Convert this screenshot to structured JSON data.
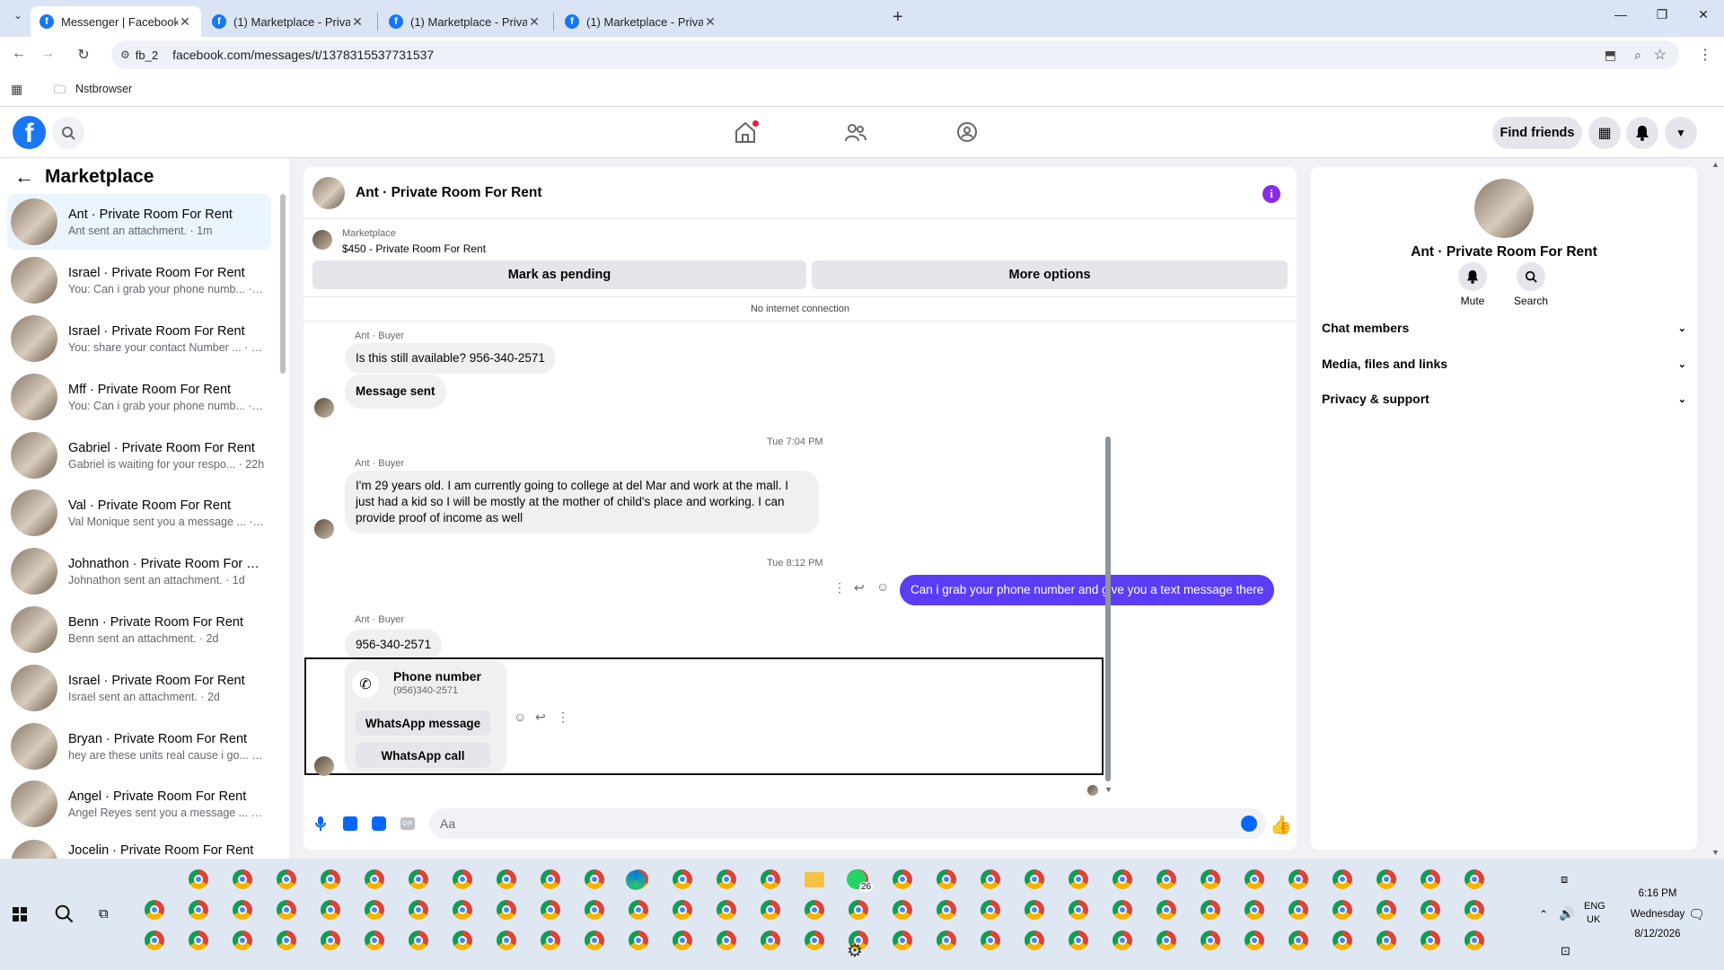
{
  "browser": {
    "tabs": [
      {
        "title": "Messenger | Facebook",
        "active": true
      },
      {
        "title": "(1) Marketplace - Private Room",
        "active": false
      },
      {
        "title": "(1) Marketplace - Private Room",
        "active": false
      },
      {
        "title": "(1) Marketplace - Private Room",
        "active": false
      }
    ],
    "site_chip": "fb_2",
    "url": "facebook.com/messages/t/1378315537731537",
    "bookmark": "Nstbrowser"
  },
  "fb_header": {
    "find_friends": "Find friends",
    "brand_color": "#1877f2"
  },
  "sidebar": {
    "title": "Marketplace",
    "conversations": [
      {
        "name": "Ant · Private Room For Rent",
        "preview": "Ant sent an attachment. · 1m",
        "selected": true
      },
      {
        "name": "Israel · Private Room For Rent",
        "preview": "You: Can i grab your phone numb... · 1m"
      },
      {
        "name": "Israel · Private Room For Rent",
        "preview": "You: share your contact Number ... · 1m"
      },
      {
        "name": "Mff · Private Room For Rent",
        "preview": "You: Can i grab your phone numb... · 1m"
      },
      {
        "name": "Gabriel · Private Room For Rent",
        "preview": "Gabriel is waiting for your respo... · 22h"
      },
      {
        "name": "Val · Private Room For Rent",
        "preview": "Val Monique sent you a message ... · 1d"
      },
      {
        "name": "Johnathon · Private Room For R...",
        "preview": "Johnathon sent an attachment. · 1d"
      },
      {
        "name": "Benn · Private Room For Rent",
        "preview": "Benn sent an attachment. · 2d"
      },
      {
        "name": "Israel · Private Room For Rent",
        "preview": "Israel sent an attachment. · 2d"
      },
      {
        "name": "Bryan · Private Room For Rent",
        "preview": "hey are these units real cause i go... · 3d"
      },
      {
        "name": "Angel · Private Room For Rent",
        "preview": "Angel Reyes sent you a message ... · 3d"
      },
      {
        "name": "Jocelin · Private Room For Rent",
        "preview": ""
      }
    ]
  },
  "chat": {
    "title": "Ant · Private Room For Rent",
    "listing_label": "Marketplace",
    "listing_price": "$450 - Private Room For Rent",
    "mark_pending": "Mark as pending",
    "more_options": "More options",
    "connection_status": "No internet connection",
    "sender_label": "Ant · Buyer",
    "messages": {
      "m1": "Is this still available? 956-340-2571",
      "m2": "Message sent",
      "ts1": "Tue 7:04 PM",
      "m3": "I'm 29 years old. I am currently going to college at del Mar and work at the mall. I just had a kid so I will be mostly at the mother of child's place and working. I can provide proof of income as well",
      "ts2": "Tue 8:12 PM",
      "m4": "Can i grab your phone number and give  you a text message there",
      "m5": "956-340-2571"
    },
    "phone_card": {
      "title": "Phone number",
      "number": "(956)340-2571",
      "whatsapp_message": "WhatsApp message",
      "whatsapp_call": "WhatsApp call"
    },
    "composer_placeholder": "Aa",
    "outgoing_color": "#5b3df5"
  },
  "right_panel": {
    "title": "Ant · Private Room For Rent",
    "mute": "Mute",
    "search": "Search",
    "sections": [
      "Chat members",
      "Media, files and links",
      "Privacy & support"
    ]
  },
  "taskbar": {
    "whatsapp_badge": "26",
    "lang_top": "ENG",
    "lang_bottom": "UK",
    "time": "6:16 PM",
    "day": "Wednesday",
    "date": "8/12/2026"
  }
}
